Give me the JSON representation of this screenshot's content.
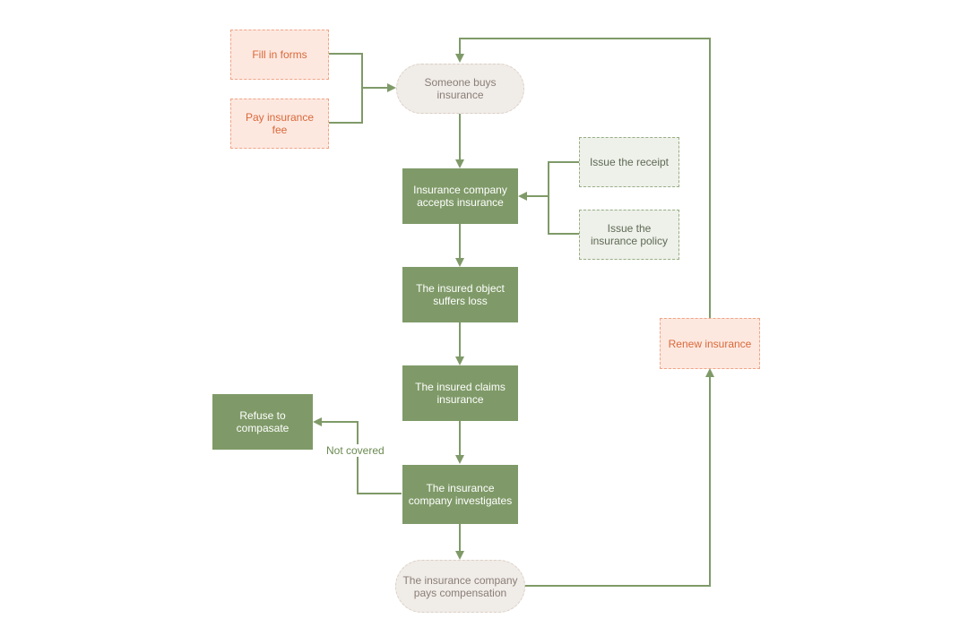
{
  "nodes": {
    "fill_forms": "Fill in forms",
    "pay_fee": "Pay insurance fee",
    "buys": "Someone buys insurance",
    "receipt": "Issue the receipt",
    "policy": "Issue the insurance policy",
    "accepts": "Insurance company accepts insurance",
    "loss": "The insured object suffers loss",
    "claims": "The insured claims insurance",
    "investigates": "The insurance company investigates",
    "refuse": "Refuse to compasate",
    "pays": "The insurance company pays compensation",
    "renew": "Renew insurance"
  },
  "edge_labels": {
    "not_covered": "Not covered"
  },
  "colors": {
    "primary": "#7f9a68",
    "line": "#7f9a68",
    "accent_orange": "#d9693a"
  }
}
